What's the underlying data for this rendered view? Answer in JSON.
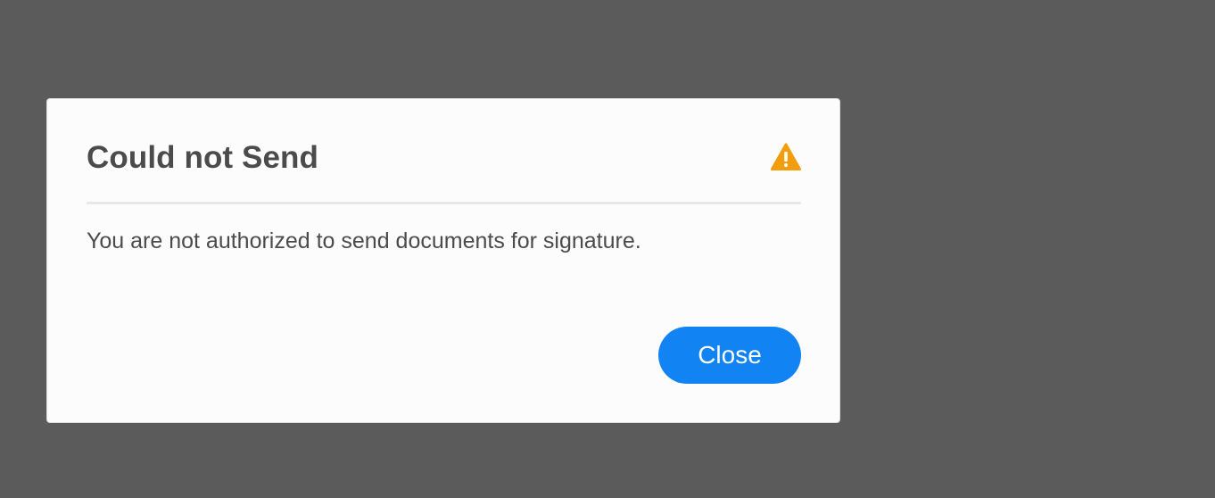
{
  "dialog": {
    "title": "Could not Send",
    "icon": "warning-icon",
    "message": "You are not authorized to send documents for signature.",
    "close_label": "Close"
  },
  "colors": {
    "overlay": "#5b5b5b",
    "dialog_background": "#fcfcfc",
    "text": "#4b4b4b",
    "warning": "#f29e0c",
    "button": "#1183f3"
  }
}
